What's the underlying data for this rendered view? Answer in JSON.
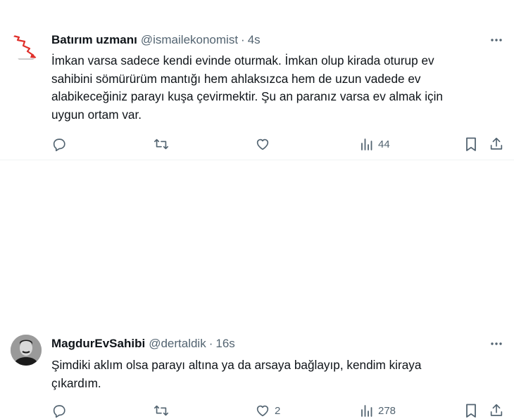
{
  "tweets": [
    {
      "name": "Batırım uzmanı",
      "handle": "@ismailekonomist",
      "separator": "·",
      "time": "4s",
      "lines": [
        "İmkan varsa sadece kendi evinde oturmak. İmkan olup kirada oturup ev",
        "sahibini sömürürüm mantığı hem ahlaksızca hem de uzun vadede ev",
        "alabikeceğiniz parayı kuşa çevirmektir. Şu an paranız varsa ev almak için",
        "uygun ortam var."
      ],
      "actions": {
        "reply": "",
        "retweet": "",
        "like": "",
        "views": "44"
      }
    },
    {
      "name": "MagdurEvSahibi",
      "handle": "@dertaldik",
      "separator": "·",
      "time": "16s",
      "lines": [
        "Şimdiki aklım olsa parayı altına ya da arsaya bağlayıp, kendim kiraya",
        "çıkardım."
      ],
      "actions": {
        "reply": "",
        "retweet": "",
        "like": "2",
        "views": "278"
      }
    }
  ],
  "colors": {
    "text": "#0f1419",
    "secondary": "#536471",
    "divider": "#eff3f4",
    "logo_red": "#e0302b"
  },
  "icons": [
    "more-icon",
    "reply-icon",
    "retweet-icon",
    "like-icon",
    "views-icon",
    "bookmark-icon",
    "share-icon"
  ]
}
